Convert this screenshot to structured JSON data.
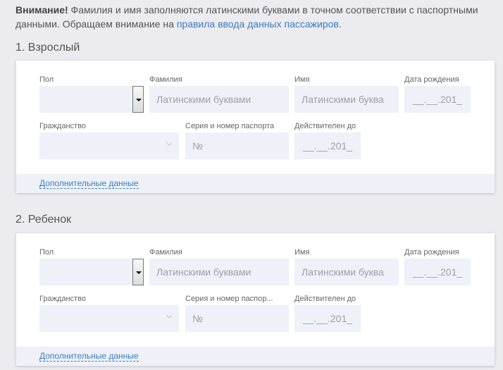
{
  "notice": {
    "bold": "Внимание!",
    "text": " Фамилия и имя заполняются латинскими буквами в точном соответствии с паспортными данными. Обращаем внимание на ",
    "link": "правила ввода данных пассажиров",
    "end": "."
  },
  "passengers": [
    {
      "title": "1. Взрослый",
      "labels": {
        "gender": "Пол",
        "surname": "Фамилия",
        "name": "Имя",
        "birth": "Дата рождения",
        "citizenship": "Гражданство",
        "passport": "Серия и номер паспорта",
        "valid": "Действителен до"
      },
      "placeholders": {
        "surname": "Латинскими буквами",
        "name": "Латинскими буква",
        "birth": "__.__.201_",
        "passport": "№",
        "valid": "__.__.201_"
      },
      "more": "Дополнительные данные"
    },
    {
      "title": "2. Ребенок",
      "labels": {
        "gender": "Пол",
        "surname": "Фамилия",
        "name": "Имя",
        "birth": "Дата рождения",
        "citizenship": "Гражданство",
        "passport": "Серия и номер паспор...",
        "valid": "Действителен до"
      },
      "placeholders": {
        "surname": "Латинскими буквами",
        "name": "Латинскими буква",
        "birth": "__.__.201_",
        "passport": "№",
        "valid": "__.__.201_"
      },
      "more": "Дополнительные данные"
    }
  ]
}
